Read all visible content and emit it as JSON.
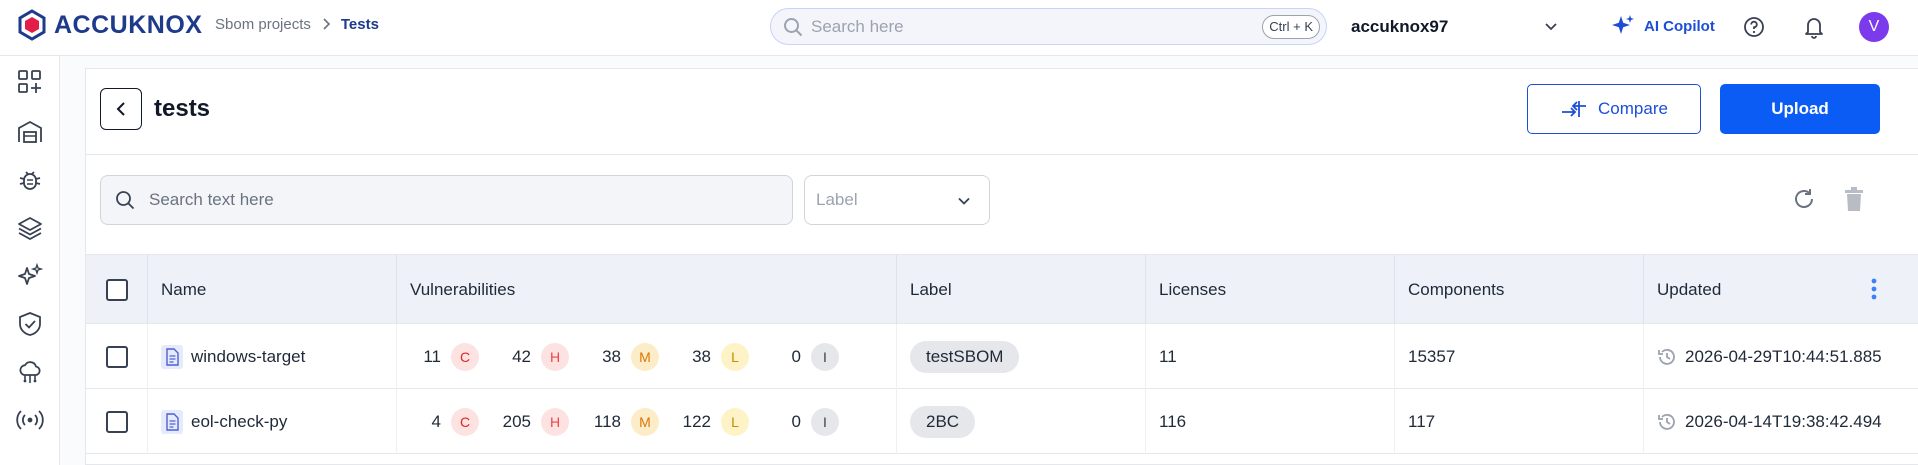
{
  "brand": {
    "name": "ACCUKNOX",
    "color": "#1e3a8a"
  },
  "breadcrumb": {
    "parent": "Sbom projects",
    "current": "Tests"
  },
  "search": {
    "placeholder": "Search here",
    "shortcut": "Ctrl + K"
  },
  "tenant": {
    "name": "accuknox97"
  },
  "copilot": {
    "label": "AI Copilot"
  },
  "user": {
    "initial": "V",
    "avatar_color": "#7c3aed"
  },
  "sidebar": {
    "items": [
      {
        "icon": "dashboard-add-icon"
      },
      {
        "icon": "warehouse-icon"
      },
      {
        "icon": "bug-icon"
      },
      {
        "icon": "layers-icon"
      },
      {
        "icon": "sparkle-icon"
      },
      {
        "icon": "shield-check-icon"
      },
      {
        "icon": "cloud-network-icon"
      },
      {
        "icon": "broadcast-icon"
      }
    ]
  },
  "page": {
    "title": "tests",
    "compare_label": "Compare",
    "upload_label": "Upload",
    "table_search_placeholder": "Search text here",
    "label_placeholder": "Label"
  },
  "table": {
    "columns": [
      "Name",
      "Vulnerabilities",
      "Label",
      "Licenses",
      "Components",
      "Updated"
    ],
    "rows": [
      {
        "name": "windows-target",
        "vulns": {
          "C": "11",
          "H": "42",
          "M": "38",
          "L": "38",
          "I": "0"
        },
        "label": "testSBOM",
        "licenses": "11",
        "components": "15357",
        "updated": "2026-04-29T10:44:51.885"
      },
      {
        "name": "eol-check-py",
        "vulns": {
          "C": "4",
          "H": "205",
          "M": "118",
          "L": "122",
          "I": "0"
        },
        "label": "2BC",
        "licenses": "116",
        "components": "117",
        "updated": "2026-04-14T19:38:42.494"
      }
    ]
  },
  "severity_letters": {
    "C": "C",
    "H": "H",
    "M": "M",
    "L": "L",
    "I": "I"
  },
  "colors": {
    "primary": "#0b5cf5",
    "critical": "#dc2626",
    "medium": "#d97706",
    "low": "#ca8a04"
  }
}
